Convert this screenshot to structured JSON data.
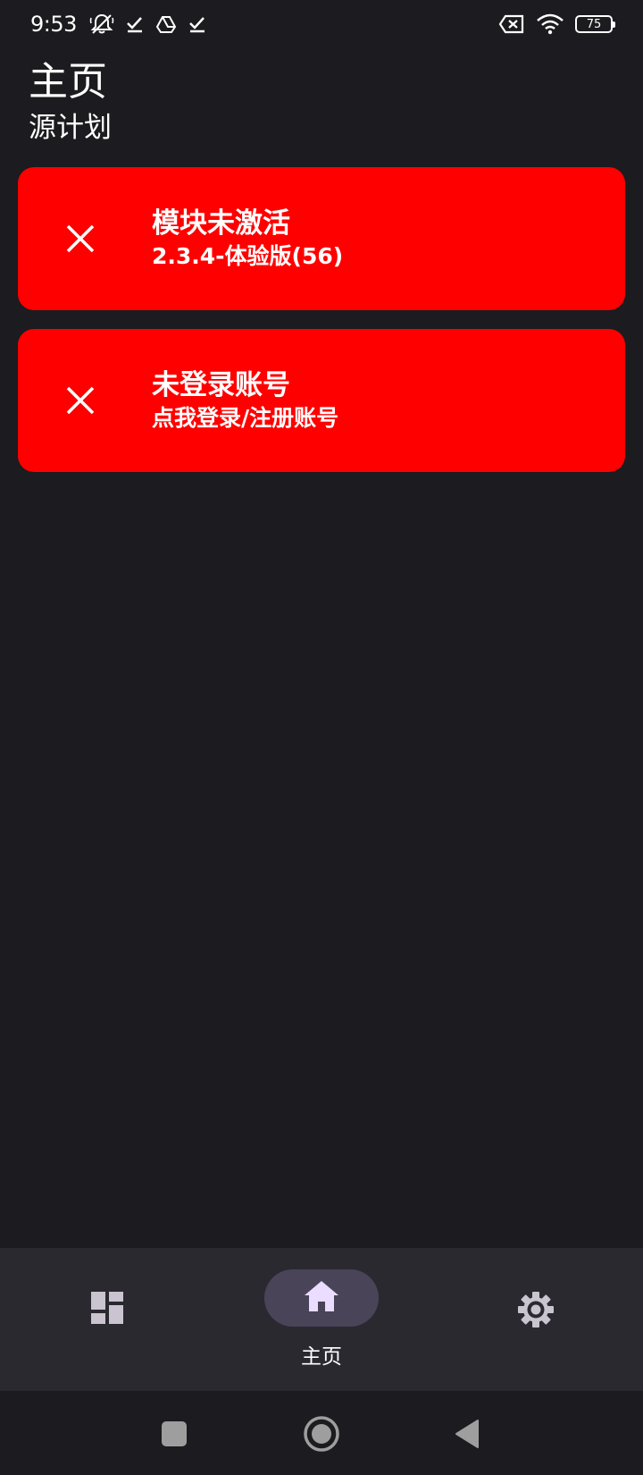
{
  "status_bar": {
    "time": "9:53",
    "battery": "75",
    "icons": [
      "bell-off-icon",
      "check-download-icon",
      "drive-icon",
      "check-download-icon",
      "sim-off-icon",
      "wifi-icon",
      "battery-icon"
    ]
  },
  "header": {
    "title": "主页",
    "subtitle": "源计划"
  },
  "cards": [
    {
      "title": "模块未激活",
      "subtitle": "2.3.4-体验版(56)",
      "icon": "close-icon",
      "color": "#ff0000"
    },
    {
      "title": "未登录账号",
      "subtitle": "点我登录/注册账号",
      "icon": "close-icon",
      "color": "#ff0000"
    }
  ],
  "bottom_nav": {
    "items": [
      {
        "icon": "dashboard-icon",
        "label": "",
        "selected": false
      },
      {
        "icon": "home-icon",
        "label": "主页",
        "selected": true
      },
      {
        "icon": "gear-icon",
        "label": "",
        "selected": false
      }
    ]
  },
  "system_nav": [
    "recent-apps-icon",
    "home-circle-icon",
    "back-icon"
  ],
  "colors": {
    "background": "#1c1b1f",
    "card": "#ff0000",
    "nav_bar": "#2b2930",
    "nav_pill": "#4a4458"
  }
}
